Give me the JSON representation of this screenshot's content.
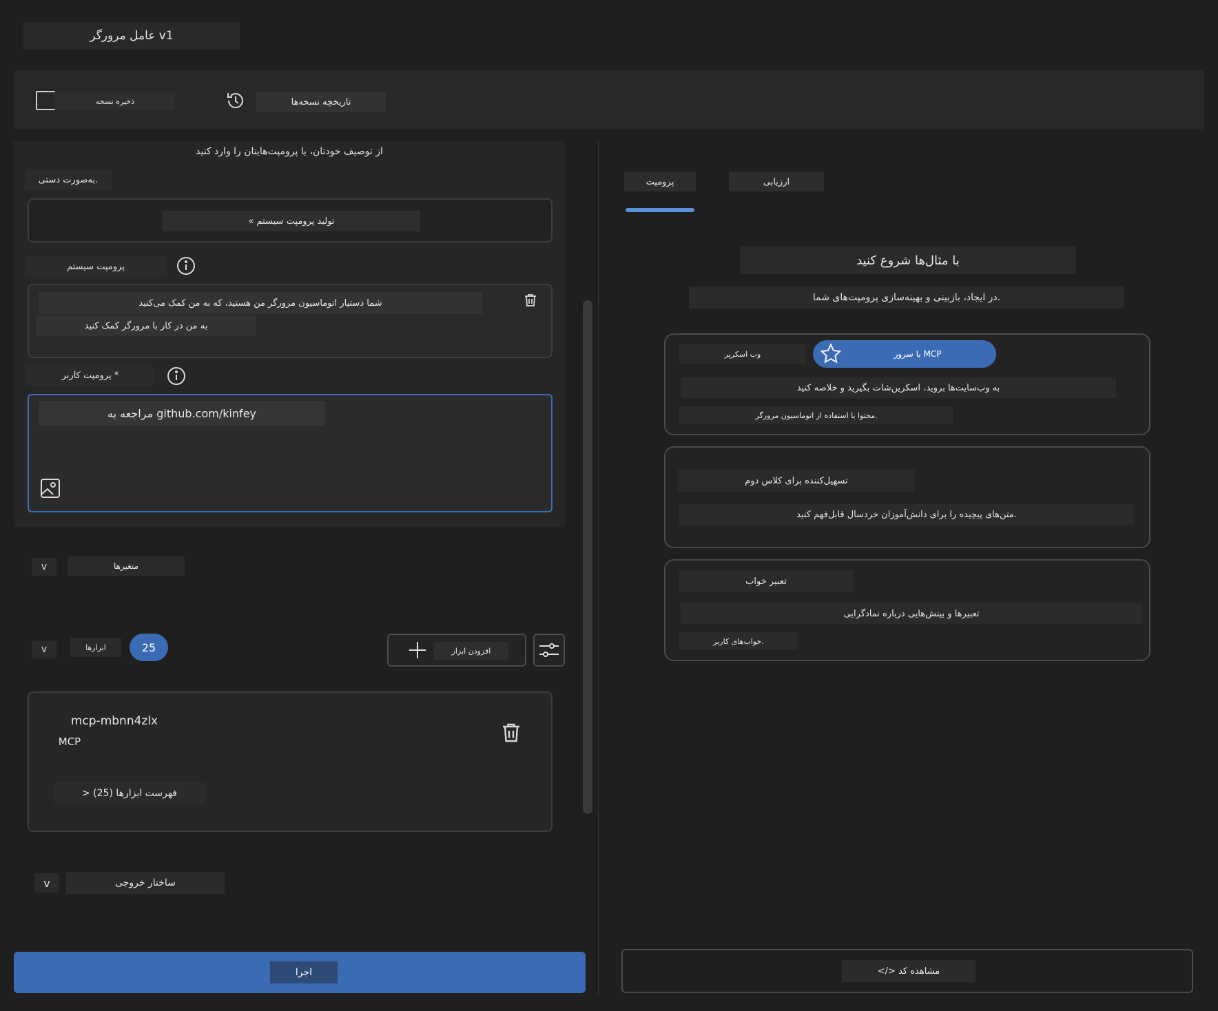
{
  "app": {
    "title": "عامل مرورگر v1"
  },
  "toolbar": {
    "save_label": "ذخیره نسخه",
    "history_label": "تاریخچه نسخه‌ها"
  },
  "left": {
    "describe_text": "از توصیف خودتان، یا پرومپت‌هایتان را وارد کنید",
    "manual_label": "به‌صورت دستی.",
    "generate_label": "« تولید پرومپت سیستم",
    "system_prompt_label": "پرومپت سیستم",
    "system_prompt_line1": "شما دستیار اتوماسیون مرورگر من هستید، که به من کمک می‌کنید",
    "system_prompt_line2": "به من در کار با مرورگر کمک کنید",
    "user_prompt_label": "پرومپت کاربر *",
    "user_prompt_value": "مراجعه به github.com/kinfey",
    "variables_label": "متغیرها",
    "tools_label": "ابزارها",
    "tools_count": "25",
    "add_tool_label": "افزودن ابزار",
    "mcp_name": "mcp-mbnn4zlx",
    "mcp_type": "MCP",
    "tools_list_label": "> فهرست ابزارها (25)",
    "output_structure_label": "ساختار خروجی",
    "chevron": "v",
    "run_label": "اجرا"
  },
  "right": {
    "tabs": [
      {
        "label": "پرومپت",
        "active": true
      },
      {
        "label": "ارزیابی",
        "active": false
      }
    ],
    "examples_title": "با مثال‌ها شروع کنید",
    "examples_subtitle": "در ایجاد، بازبینی و بهینه‌سازی پرومپت‌های شما.",
    "cards": [
      {
        "title": "وب اسکرپر",
        "badge": "با سرور MCP",
        "line1": "به وب‌سایت‌ها بروید، اسکرین‌شات بگیرید و خلاصه کنید",
        "line2": "محتوا با استفاده از اتوماسیون مرورگر."
      },
      {
        "title": "تسهیل‌کننده برای کلاس دوم",
        "line1": "متن‌های پیچیده را برای دانش‌آموزان خردسال قابل‌فهم کنید."
      },
      {
        "title": "تعبیر خواب",
        "line1": "تعبیرها و بینش‌هایی درباره نمادگرایی",
        "line2": "خواب‌های کاربر."
      }
    ],
    "view_code_label": "</> مشاهده کد"
  },
  "colors": {
    "accent": "#3c6bb5",
    "tab_indicator": "#5b8fd9",
    "background": "#1f1f1f"
  },
  "icons": {
    "history": "history-icon",
    "info": "info-icon",
    "trash": "trash-icon",
    "image": "image-icon",
    "plus": "plus-icon",
    "sliders": "sliders-icon",
    "star": "star-icon"
  }
}
